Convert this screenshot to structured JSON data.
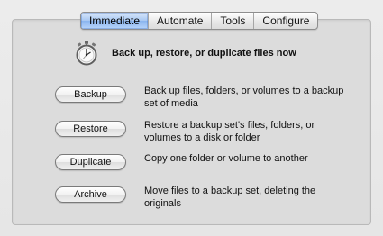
{
  "tabs": [
    {
      "label": "Immediate",
      "active": true
    },
    {
      "label": "Automate",
      "active": false
    },
    {
      "label": "Tools",
      "active": false
    },
    {
      "label": "Configure",
      "active": false
    }
  ],
  "header": {
    "icon": "stopwatch-icon",
    "title": "Back up, restore, or duplicate files now"
  },
  "actions": [
    {
      "label": "Backup",
      "description": "Back up files, folders, or volumes to a backup set of media"
    },
    {
      "label": "Restore",
      "description": "Restore a backup set's files, folders, or volumes to a disk or folder"
    },
    {
      "label": "Duplicate",
      "description": "Copy one folder or volume to another"
    },
    {
      "label": "Archive",
      "description": "Move files to a backup set, deleting the originals"
    }
  ],
  "colors": {
    "active_tab": "#8ab5ee",
    "panel_bg": "#dcdcdc"
  }
}
